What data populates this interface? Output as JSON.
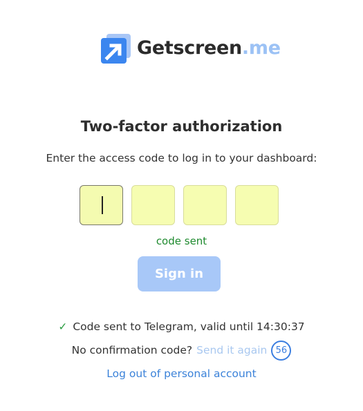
{
  "brand": {
    "name": "Getscreen",
    "tld": ".me",
    "logo_icon": "arrow-icon",
    "colors": {
      "mark": "#3b86ef",
      "mark_light": "#a8c6f6",
      "tld": "#9cc2f5"
    }
  },
  "auth": {
    "title": "Two-factor authorization",
    "subtitle": "Enter the access code to log in to your dashboard:",
    "code_digits": [
      "",
      "",
      "",
      ""
    ],
    "status": "code sent",
    "signin_label": "Sign in",
    "sent_info": "Code sent to Telegram, valid until 14:30:37",
    "resend_prompt": "No confirmation code?",
    "resend_link": "Send it again",
    "resend_timer": "56",
    "logout_link": "Log out of personal account"
  },
  "colors": {
    "input_bg": "#f6fdb1",
    "status": "#1e8a2e",
    "button_bg": "#a8c8f8",
    "link": "#3b82d9"
  }
}
